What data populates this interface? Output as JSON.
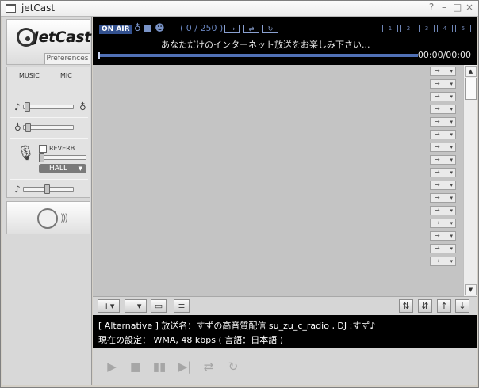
{
  "window": {
    "title": "jetCast",
    "controls": [
      "?",
      "–",
      "□",
      "×"
    ]
  },
  "logo": {
    "text": "JetCast"
  },
  "preferences_tab": "Preferences",
  "mixer": {
    "music_label": "MUSIC",
    "mic_label": "MIC",
    "reverb_label": "REVERB",
    "reverb_checked": false,
    "reverb_type": "HALL"
  },
  "status": {
    "onair": "ON AIR",
    "count": "(  0 / 250  )",
    "marquee": "あなただけのインターネット放送をお楽しみ下さい...",
    "time": "00:00/00:00",
    "progress": 0,
    "slots": [
      "1",
      "2",
      "3",
      "4",
      "5"
    ]
  },
  "playlist": {
    "row_count": 16,
    "row_action_icon": "→",
    "rows": []
  },
  "info": {
    "line1": "[ Alternative ] 放送名：すずの高音質配信 su_zu_c_radio , DJ :すず♪",
    "line2": "現在の設定： WMA, 48 kbps ( 言語：日本語 )"
  },
  "colors": {
    "status_bg": "#000000",
    "accent_blue": "#5070b5",
    "panel_gray": "#d8d8d8",
    "playlist_gray": "#c4c4c4"
  }
}
